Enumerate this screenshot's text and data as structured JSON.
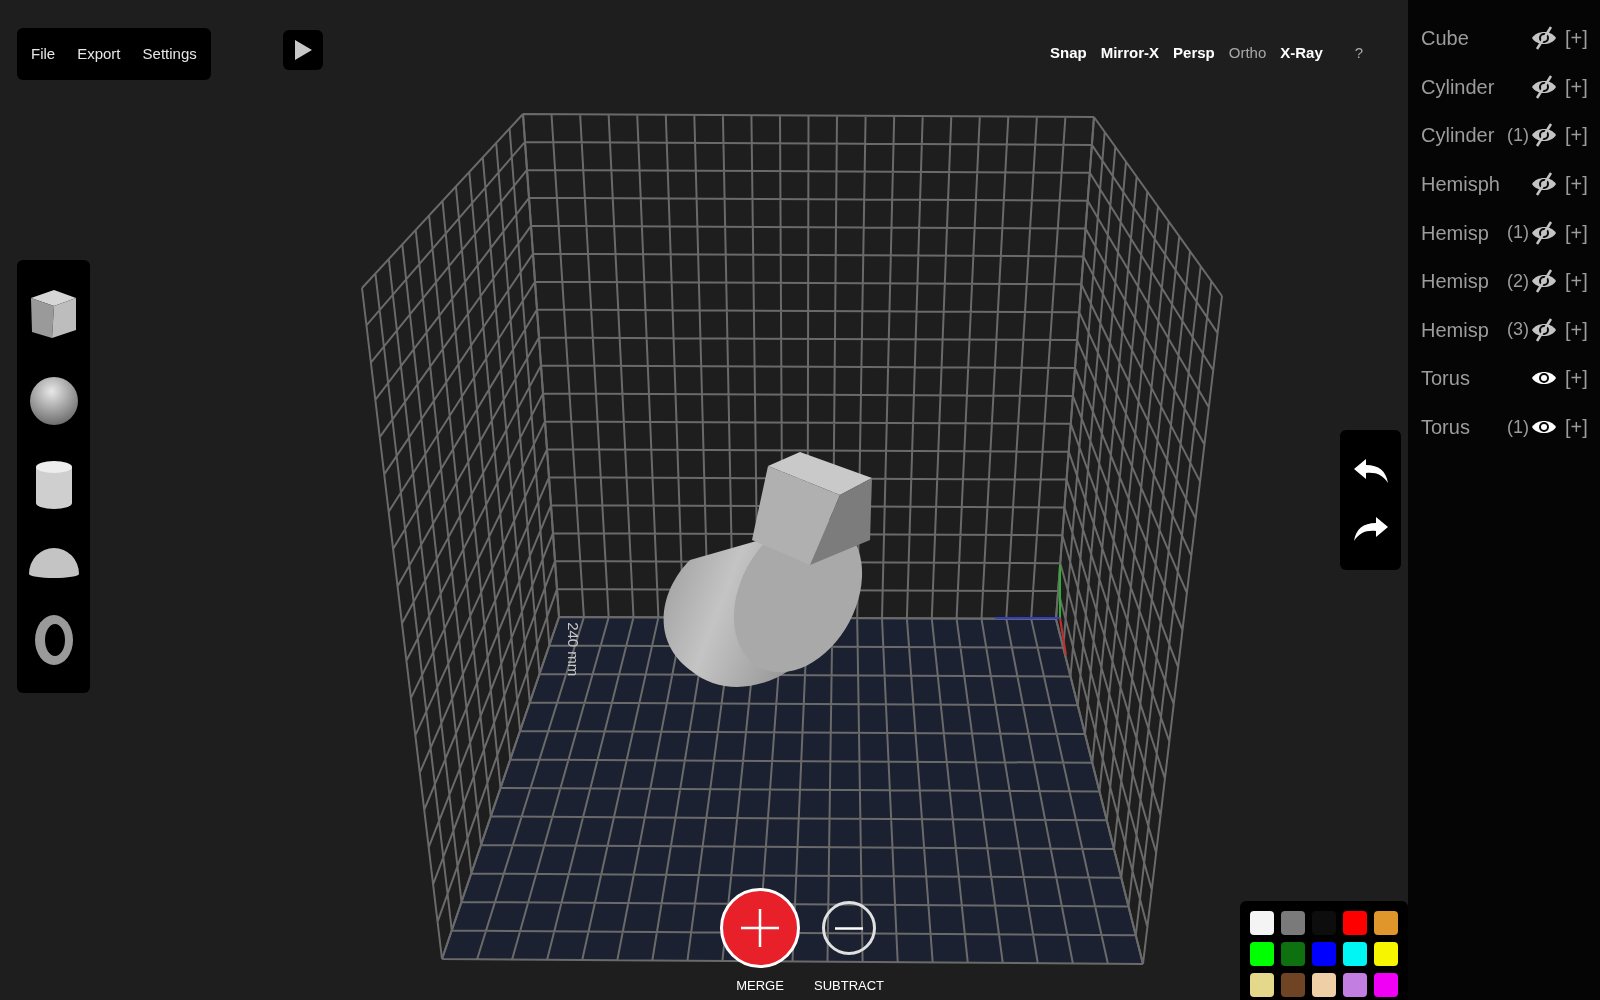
{
  "menu": [
    {
      "label": "File"
    },
    {
      "label": "Export"
    },
    {
      "label": "Settings"
    }
  ],
  "toggles": [
    {
      "label": "Snap",
      "on": true
    },
    {
      "label": "Mirror-X",
      "on": true
    },
    {
      "label": "Persp",
      "on": true
    },
    {
      "label": "Ortho",
      "on": false
    },
    {
      "label": "X-Ray",
      "on": true
    }
  ],
  "help": "?",
  "floor_label": "240 mm",
  "operations": [
    {
      "kind": "merge",
      "label": "MERGE",
      "selected": true
    },
    {
      "kind": "subtract",
      "label": "SUBTRACT",
      "selected": false
    }
  ],
  "palette": [
    {
      "color": "#f4f4f4"
    },
    {
      "color": "#7a7a7a"
    },
    {
      "color": "#0d0d0d"
    },
    {
      "color": "#ff0000"
    },
    {
      "color": "#e0962a"
    },
    {
      "color": "#00ff00"
    },
    {
      "color": "#0f7010"
    },
    {
      "color": "#0000ff"
    },
    {
      "color": "#00f5f5"
    },
    {
      "color": "#f8f500"
    },
    {
      "color": "#e4d98a"
    },
    {
      "color": "#6e4424"
    },
    {
      "color": "#efcfa6"
    },
    {
      "color": "#c27ee0"
    },
    {
      "color": "#f000f5"
    }
  ],
  "objects": [
    {
      "name": "Cube",
      "visible": false,
      "add": "[+]"
    },
    {
      "name": "Cylinder",
      "visible": false,
      "add": "[+]"
    },
    {
      "name": "Cylinder",
      "suffix": "(1)",
      "visible": false,
      "add": "[+]"
    },
    {
      "name": "Hemisph",
      "visible": false,
      "add": "[+]"
    },
    {
      "name": "Hemisp",
      "suffix": "(1)",
      "visible": false,
      "add": "[+]"
    },
    {
      "name": "Hemisp",
      "suffix": "(2)",
      "visible": false,
      "add": "[+]"
    },
    {
      "name": "Hemisp",
      "suffix": "(3)",
      "visible": false,
      "add": "[+]"
    },
    {
      "name": "Torus",
      "visible": true,
      "add": "[+]"
    },
    {
      "name": "Torus",
      "suffix": "(1)",
      "visible": true,
      "add": "[+]"
    }
  ]
}
